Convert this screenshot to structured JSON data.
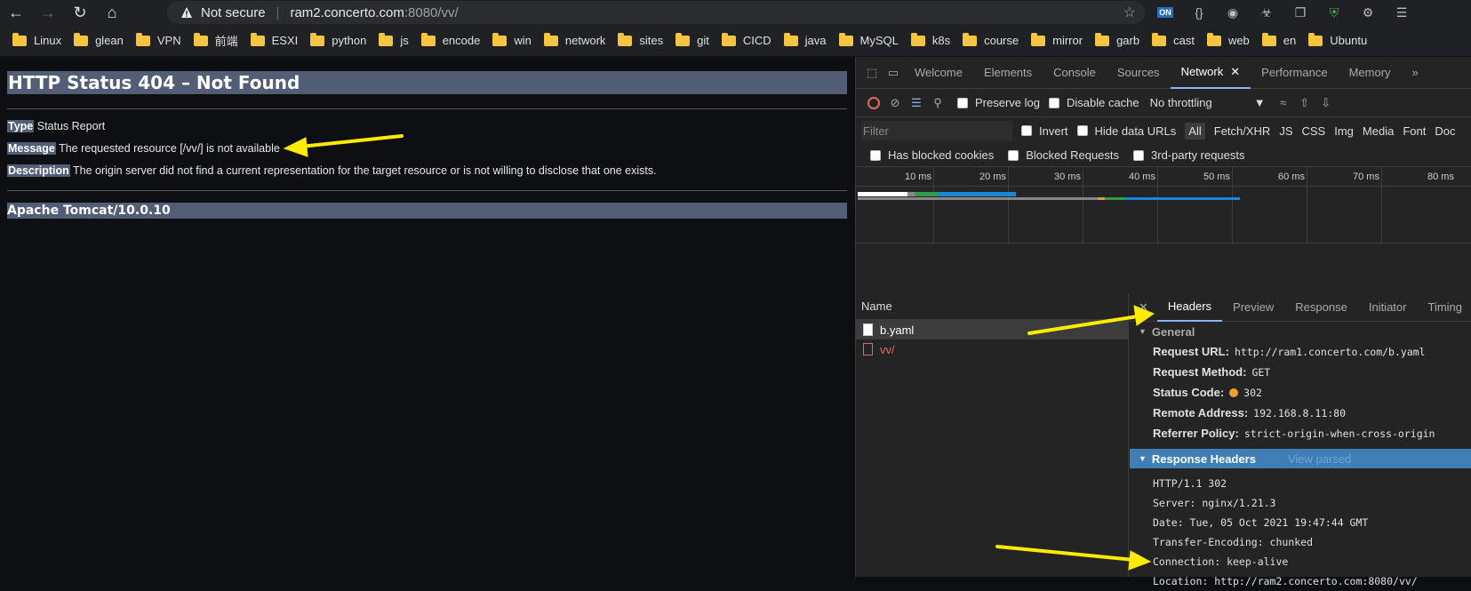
{
  "browser": {
    "security_label": "Not secure",
    "url_host": "ram2.concerto.com",
    "url_rest": ":8080/vv/",
    "ext_badge": "ON"
  },
  "bookmarks": [
    "Linux",
    "glean",
    "VPN",
    "前端",
    "ESXI",
    "python",
    "js",
    "encode",
    "win",
    "network",
    "sites",
    "git",
    "CICD",
    "java",
    "MySQL",
    "k8s",
    "course",
    "mirror",
    "garb",
    "cast",
    "web",
    "en",
    "Ubuntu"
  ],
  "page": {
    "title": "HTTP Status 404 – Not Found",
    "type_label": "Type",
    "type_value": "Status Report",
    "message_label": "Message",
    "message_value": "The requested resource [/vv/] is not available",
    "description_label": "Description",
    "description_value": "The origin server did not find a current representation for the target resource or is not willing to disclose that one exists.",
    "footer": "Apache Tomcat/10.0.10"
  },
  "devtools": {
    "tabs": [
      "Welcome",
      "Elements",
      "Console",
      "Sources",
      "Network",
      "Performance",
      "Memory"
    ],
    "toolbar": {
      "preserve_log": "Preserve log",
      "disable_cache": "Disable cache",
      "throttling": "No throttling"
    },
    "filter_placeholder": "Filter",
    "invert": "Invert",
    "hide_data_urls": "Hide data URLs",
    "types": [
      "All",
      "Fetch/XHR",
      "JS",
      "CSS",
      "Img",
      "Media",
      "Font",
      "Doc"
    ],
    "blocked_cookies": "Has blocked cookies",
    "blocked_requests": "Blocked Requests",
    "third_party": "3rd-party requests",
    "ticks": [
      "10 ms",
      "20 ms",
      "30 ms",
      "40 ms",
      "50 ms",
      "60 ms",
      "70 ms",
      "80 ms"
    ],
    "name_header": "Name",
    "requests": [
      "b.yaml",
      "vv/"
    ],
    "detail_tabs": [
      "Headers",
      "Preview",
      "Response",
      "Initiator",
      "Timing"
    ],
    "general": {
      "title": "General",
      "request_url_label": "Request URL:",
      "request_url": "http://ram1.concerto.com/b.yaml",
      "method_label": "Request Method:",
      "method": "GET",
      "status_label": "Status Code:",
      "status": "302",
      "remote_label": "Remote Address:",
      "remote": "192.168.8.11:80",
      "referrer_label": "Referrer Policy:",
      "referrer": "strict-origin-when-cross-origin"
    },
    "response_headers": {
      "title": "Response Headers",
      "view_parsed": "View parsed",
      "lines": [
        "HTTP/1.1 302",
        "Server: nginx/1.21.3",
        "Date: Tue, 05 Oct 2021 19:47:44 GMT",
        "Transfer-Encoding: chunked",
        "Connection: keep-alive",
        "Location: http://ram2.concerto.com:8080/vv/"
      ]
    }
  }
}
